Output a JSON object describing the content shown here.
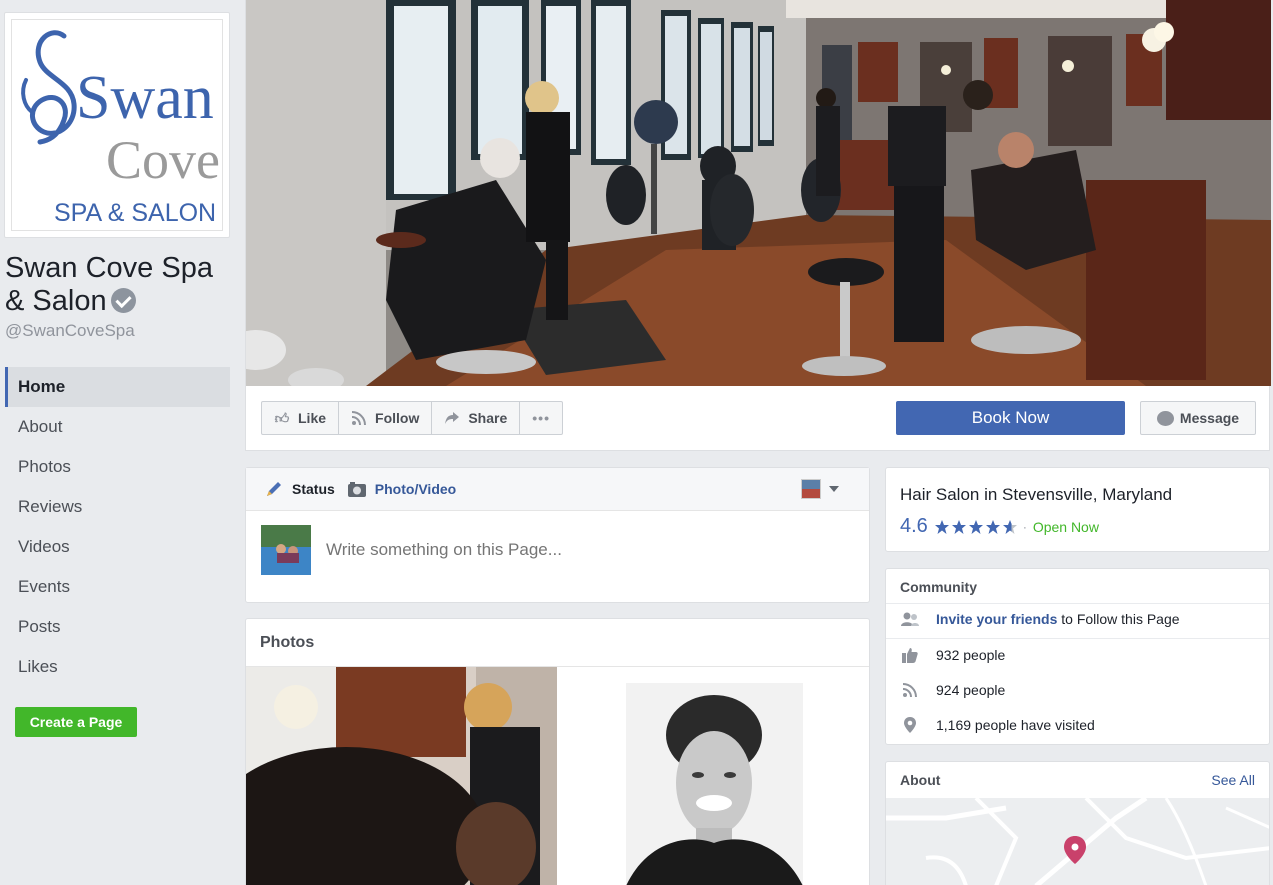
{
  "logo": {
    "line1": "Swan",
    "line2": "Cove",
    "tagline": "SPA & SALON",
    "brand_color": "#3d64ad",
    "accent_color": "#9a9a9a"
  },
  "page": {
    "name": "Swan Cove Spa & Salon",
    "handle": "@SwanCoveSpa",
    "verified_icon": "verified-badge-icon"
  },
  "nav": {
    "items": [
      {
        "label": "Home",
        "active": true
      },
      {
        "label": "About"
      },
      {
        "label": "Photos"
      },
      {
        "label": "Reviews"
      },
      {
        "label": "Videos"
      },
      {
        "label": "Events"
      },
      {
        "label": "Posts"
      },
      {
        "label": "Likes"
      }
    ]
  },
  "sidebar": {
    "create_page_label": "Create a Page"
  },
  "actions": {
    "like": "Like",
    "follow": "Follow",
    "share": "Share",
    "more_icon": "more-dots-icon",
    "book_now": "Book Now",
    "message": "Message"
  },
  "composer": {
    "tab_status": "Status",
    "tab_photo": "Photo/Video",
    "placeholder": "Write something on this Page..."
  },
  "photos": {
    "title": "Photos"
  },
  "info": {
    "category": "Hair Salon in Stevensville, Maryland",
    "rating": "4.6",
    "stars": 4.6,
    "status": "Open Now",
    "status_color": "#42b72a"
  },
  "community": {
    "title": "Community",
    "invite_link": "Invite your friends",
    "invite_rest": " to Follow this Page",
    "likes": "932 people",
    "follows": "924 people",
    "visits": "1,169 people have visited"
  },
  "about": {
    "title": "About",
    "see_all": "See All"
  },
  "colors": {
    "primary": "#4267b2",
    "link": "#365899",
    "green": "#42b72a",
    "background": "#e9ebee"
  }
}
